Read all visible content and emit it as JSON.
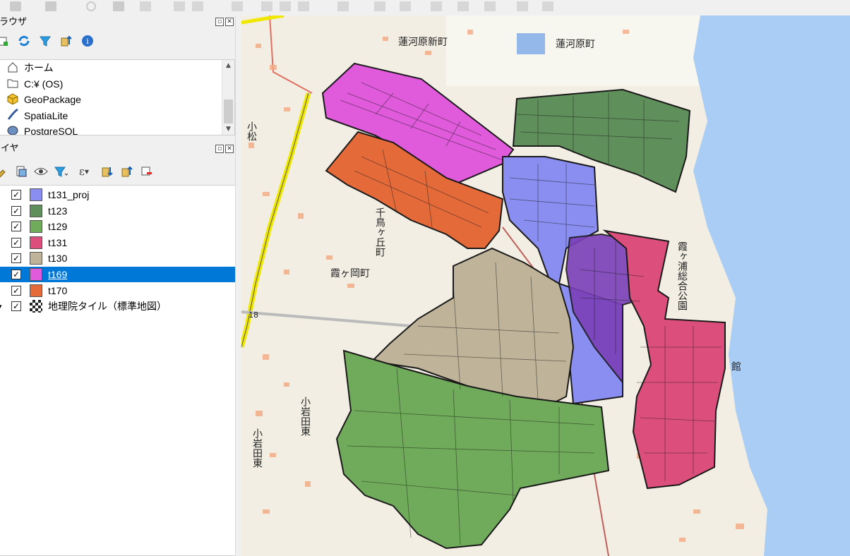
{
  "browser": {
    "title": "ブラウザ",
    "items": [
      {
        "label": "ホーム",
        "icon": "home-icon"
      },
      {
        "label": "C:¥ (OS)",
        "icon": "folder-icon"
      },
      {
        "label": "GeoPackage",
        "icon": "geopackage-icon"
      },
      {
        "label": "SpatiaLite",
        "icon": "spatialite-icon"
      },
      {
        "label": "PostgreSQL",
        "icon": "postgresql-icon"
      }
    ]
  },
  "layers": {
    "title": "レイヤ",
    "items": [
      {
        "name": "t131_proj",
        "color": "#8a8ef0",
        "checked": true
      },
      {
        "name": "t123",
        "color": "#5f8f5a",
        "checked": true
      },
      {
        "name": "t129",
        "color": "#6fab5a",
        "checked": true
      },
      {
        "name": "t131",
        "color": "#dc4f7c",
        "checked": true
      },
      {
        "name": "t130",
        "color": "#bfb49a",
        "checked": true
      },
      {
        "name": "t169",
        "color": "#e05adc",
        "checked": true,
        "selected": true
      },
      {
        "name": "t170",
        "color": "#e46a3a",
        "checked": true
      },
      {
        "name": "地理院タイル（標準地図）",
        "checked": true,
        "icon": "raster-tile-icon"
      }
    ]
  },
  "map": {
    "labels": [
      "蓮河原新町",
      "蓮河原町",
      "小松",
      "千鳥ヶ丘町",
      "霞ヶ岡町",
      "小岩田東",
      "小岩田東",
      "霞ヶ浦総合公園",
      "館"
    ],
    "road_number": "18",
    "water_color": "#a9cdf5",
    "polygon_stroke": "#1a1a1a"
  }
}
